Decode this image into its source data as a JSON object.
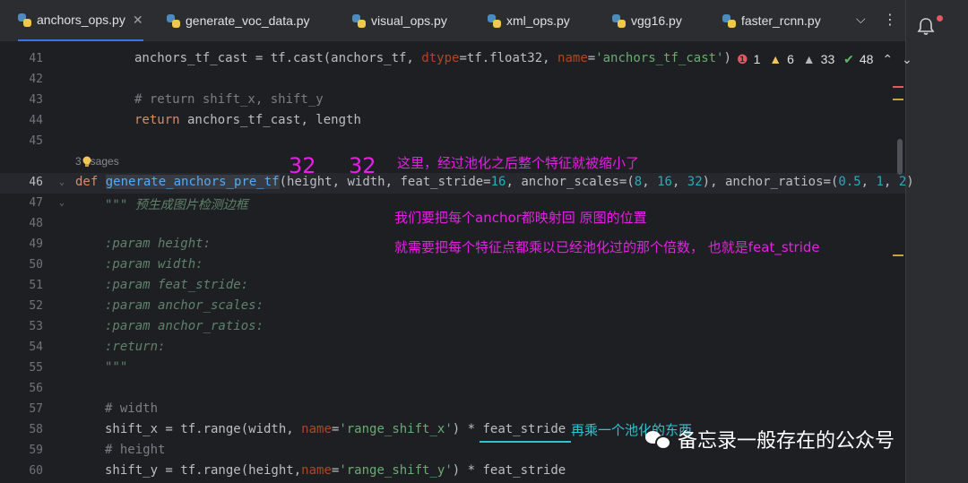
{
  "tabs": [
    {
      "label": "anchors_ops.py",
      "active": true
    },
    {
      "label": "generate_voc_data.py"
    },
    {
      "label": "visual_ops.py"
    },
    {
      "label": "xml_ops.py"
    },
    {
      "label": "vgg16.py"
    },
    {
      "label": "faster_rcnn.py"
    }
  ],
  "inspections": {
    "errors": "1",
    "warnings": "6",
    "weak_warnings": "33",
    "typos": "48"
  },
  "usages_text": "3 usages",
  "line_numbers": [
    "41",
    "42",
    "43",
    "44",
    "45",
    "46",
    "47",
    "48",
    "49",
    "50",
    "51",
    "52",
    "53",
    "54",
    "55",
    "56",
    "57",
    "58",
    "59",
    "60"
  ],
  "annotations": {
    "dim_height": "32",
    "dim_width": "32",
    "note_pool": "这里，经过池化之后整个特征就被缩小了",
    "note_map": "我们要把每个anchor都映射回 原图的位置",
    "note_stride": "就需要把每个特征点都乘以已经池化过的那个倍数， 也就是feat_stride",
    "note_multiply": "再乘一个池化的东西"
  },
  "watermark": "备忘录一般存在的公众号",
  "colors": {
    "accent": "#3574f0",
    "annotation_magenta": "#e81ee8",
    "annotation_cyan": "#28c7d6"
  }
}
